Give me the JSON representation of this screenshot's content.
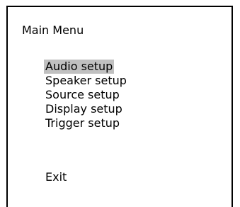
{
  "menu": {
    "title": "Main Menu",
    "items": [
      {
        "label": "Audio setup",
        "selected": true
      },
      {
        "label": "Speaker setup",
        "selected": false
      },
      {
        "label": "Source setup",
        "selected": false
      },
      {
        "label": "Display setup",
        "selected": false
      },
      {
        "label": "Trigger setup",
        "selected": false
      }
    ],
    "exit_label": "Exit",
    "highlight_color": "#c0c0c0"
  }
}
